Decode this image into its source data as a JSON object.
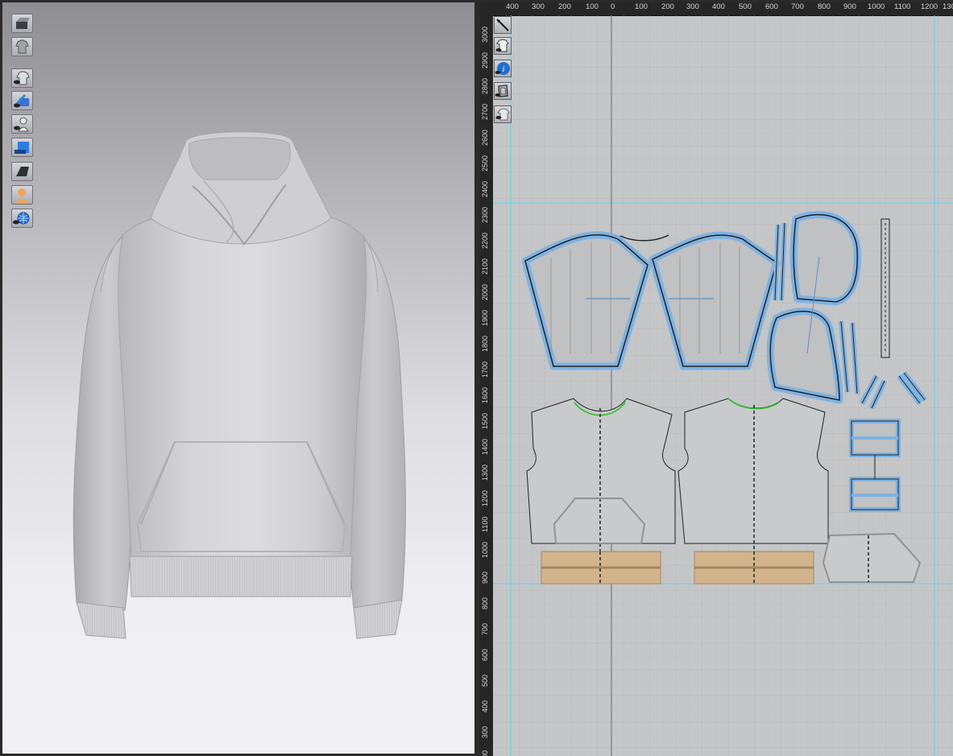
{
  "viewport_3d": {
    "toolbar": [
      {
        "name": "simulation-icon"
      },
      {
        "name": "garment-display-icon"
      },
      {
        "name": "show-garment-icon"
      },
      {
        "name": "show-texture-icon"
      },
      {
        "name": "show-avatar-icon"
      },
      {
        "name": "show-3d-pen-icon"
      },
      {
        "name": "show-lines-icon"
      },
      {
        "name": "avatar-icon"
      },
      {
        "name": "environment-icon"
      }
    ]
  },
  "pattern_window": {
    "toolbar": [
      {
        "name": "edit-pattern-icon"
      },
      {
        "name": "show-pattern-icon"
      },
      {
        "name": "info-icon"
      },
      {
        "name": "pattern-outline-icon"
      },
      {
        "name": "show-arrangement-icon"
      }
    ],
    "ruler_top": [
      "400",
      "300",
      "200",
      "100",
      "0",
      "100",
      "200",
      "300",
      "400",
      "500",
      "600",
      "700",
      "800",
      "900",
      "1000",
      "1100",
      "1200",
      "130"
    ],
    "ruler_left": [
      "3000",
      "2900",
      "2800",
      "2700",
      "2600",
      "2500",
      "2400",
      "2300",
      "2200",
      "2100",
      "2000",
      "1900",
      "1800",
      "1700",
      "1600",
      "1500",
      "1400",
      "1300",
      "1200",
      "1100",
      "1000",
      "900",
      "800",
      "700",
      "600",
      "500",
      "400",
      "300",
      "200"
    ]
  },
  "colors": {
    "selected_outline": "#7fb2e0",
    "rib_fill": "#d2b48c",
    "sewing_line": "#27c027",
    "grid_major": "#b4b6b8"
  }
}
